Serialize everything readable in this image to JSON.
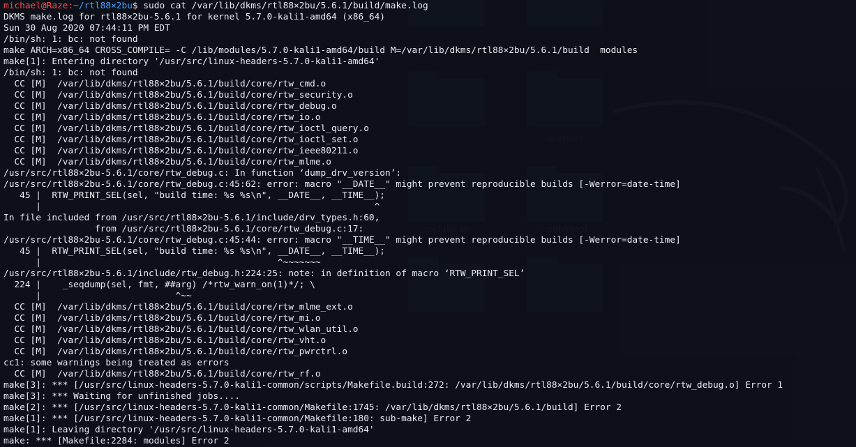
{
  "prompt": {
    "user": "michael@Raze",
    "separator": ":",
    "path": "~/rtl88×2bu",
    "dollar": "$ ",
    "command": "sudo cat /var/lib/dkms/rtl88×2bu/5.6.1/build/make.log"
  },
  "desktop_labels": [
    "sherlock",
    "socialscan",
    "spiderfoot"
  ],
  "lines": [
    "DKMS make.log for rtl88×2bu-5.6.1 for kernel 5.7.0-kali1-amd64 (x86_64)",
    "Sun 30 Aug 2020 07:44:11 PM EDT",
    "/bin/sh: 1: bc: not found",
    "make ARCH=x86_64 CROSS_COMPILE= -C /lib/modules/5.7.0-kali1-amd64/build M=/var/lib/dkms/rtl88×2bu/5.6.1/build  modules",
    "make[1]: Entering directory '/usr/src/linux-headers-5.7.0-kali1-amd64'",
    "/bin/sh: 1: bc: not found",
    "  CC [M]  /var/lib/dkms/rtl88×2bu/5.6.1/build/core/rtw_cmd.o",
    "  CC [M]  /var/lib/dkms/rtl88×2bu/5.6.1/build/core/rtw_security.o",
    "  CC [M]  /var/lib/dkms/rtl88×2bu/5.6.1/build/core/rtw_debug.o",
    "  CC [M]  /var/lib/dkms/rtl88×2bu/5.6.1/build/core/rtw_io.o",
    "  CC [M]  /var/lib/dkms/rtl88×2bu/5.6.1/build/core/rtw_ioctl_query.o",
    "  CC [M]  /var/lib/dkms/rtl88×2bu/5.6.1/build/core/rtw_ioctl_set.o",
    "  CC [M]  /var/lib/dkms/rtl88×2bu/5.6.1/build/core/rtw_ieee80211.o",
    "  CC [M]  /var/lib/dkms/rtl88×2bu/5.6.1/build/core/rtw_mlme.o",
    "/usr/src/rtl88×2bu-5.6.1/core/rtw_debug.c: In function ‘dump_drv_version’:",
    "/usr/src/rtl88×2bu-5.6.1/core/rtw_debug.c:45:62: error: macro \"__DATE__\" might prevent reproducible builds [-Werror=date-time]",
    "   45 |  RTW_PRINT_SEL(sel, \"build time: %s %s\\n\", __DATE__, __TIME__);",
    "      |                                                              ^",
    "In file included from /usr/src/rtl88×2bu-5.6.1/include/drv_types.h:60,",
    "                 from /usr/src/rtl88×2bu-5.6.1/core/rtw_debug.c:17:",
    "/usr/src/rtl88×2bu-5.6.1/core/rtw_debug.c:45:44: error: macro \"__TIME__\" might prevent reproducible builds [-Werror=date-time]",
    "   45 |  RTW_PRINT_SEL(sel, \"build time: %s %s\\n\", __DATE__, __TIME__);",
    "      |                                            ^~~~~~~~",
    "/usr/src/rtl88×2bu-5.6.1/include/rtw_debug.h:224:25: note: in definition of macro ‘RTW_PRINT_SEL’",
    "  224 |    _seqdump(sel, fmt, ##arg) /*rtw_warn_on(1)*/; \\",
    "      |                         ^~~",
    "  CC [M]  /var/lib/dkms/rtl88×2bu/5.6.1/build/core/rtw_mlme_ext.o",
    "  CC [M]  /var/lib/dkms/rtl88×2bu/5.6.1/build/core/rtw_mi.o",
    "  CC [M]  /var/lib/dkms/rtl88×2bu/5.6.1/build/core/rtw_wlan_util.o",
    "  CC [M]  /var/lib/dkms/rtl88×2bu/5.6.1/build/core/rtw_vht.o",
    "  CC [M]  /var/lib/dkms/rtl88×2bu/5.6.1/build/core/rtw_pwrctrl.o",
    "cc1: some warnings being treated as errors",
    "  CC [M]  /var/lib/dkms/rtl88×2bu/5.6.1/build/core/rtw_rf.o",
    "make[3]: *** [/usr/src/linux-headers-5.7.0-kali1-common/scripts/Makefile.build:272: /var/lib/dkms/rtl88×2bu/5.6.1/build/core/rtw_debug.o] Error 1",
    "make[3]: *** Waiting for unfinished jobs....",
    "make[2]: *** [/usr/src/linux-headers-5.7.0-kali1-common/Makefile:1745: /var/lib/dkms/rtl88×2bu/5.6.1/build] Error 2",
    "make[1]: *** [/usr/src/linux-headers-5.7.0-kali1-common/Makefile:180: sub-make] Error 2",
    "make[1]: Leaving directory '/usr/src/linux-headers-5.7.0-kali1-amd64'",
    "make: *** [Makefile:2284: modules] Error 2"
  ]
}
